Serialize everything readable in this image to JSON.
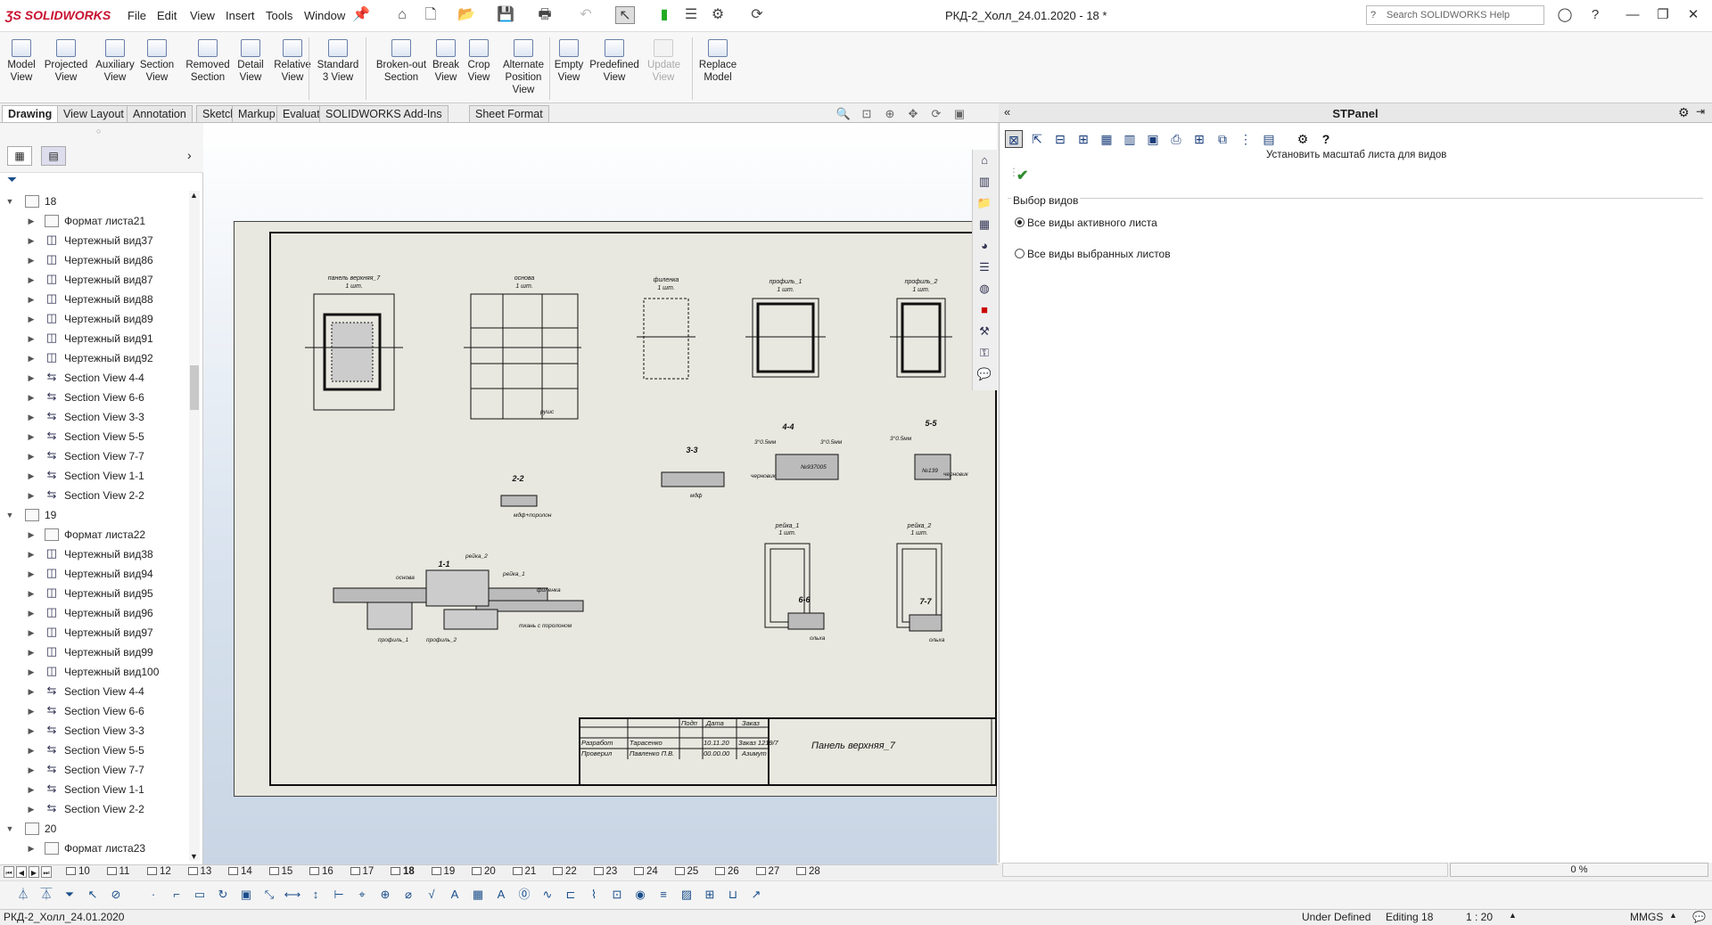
{
  "app": {
    "brand": "SOLIDWORKS",
    "doc_title": "РКД-2_Холл_24.01.2020 - 18 *",
    "search_placeholder": "Search SOLIDWORKS Help"
  },
  "menu": [
    "File",
    "Edit",
    "View",
    "Insert",
    "Tools",
    "Window"
  ],
  "ribbon": [
    {
      "label": "Model\nView"
    },
    {
      "label": "Projected\nView"
    },
    {
      "label": "Auxiliary\nView"
    },
    {
      "label": "Section\nView"
    },
    {
      "label": "Removed\nSection"
    },
    {
      "label": "Detail\nView"
    },
    {
      "label": "Relative\nView"
    },
    {
      "label": "Standard\n3 View"
    },
    {
      "label": "Broken-out\nSection"
    },
    {
      "label": "Break\nView"
    },
    {
      "label": "Crop\nView"
    },
    {
      "label": "Alternate\nPosition\nView"
    },
    {
      "label": "Empty\nView"
    },
    {
      "label": "Predefined\nView"
    },
    {
      "label": "Update\nView"
    },
    {
      "label": "Replace\nModel"
    }
  ],
  "tabs": [
    "Drawing",
    "View Layout",
    "Annotation",
    "Sketch",
    "Markup",
    "Evaluate",
    "SOLIDWORKS Add-Ins",
    "Sheet Format"
  ],
  "tree": [
    {
      "level": 0,
      "label": "18",
      "type": "sheet"
    },
    {
      "level": 1,
      "label": "Формат листа21",
      "type": "format"
    },
    {
      "level": 1,
      "label": "Чертежный вид37",
      "type": "view"
    },
    {
      "level": 1,
      "label": "Чертежный вид86",
      "type": "view"
    },
    {
      "level": 1,
      "label": "Чертежный вид87",
      "type": "view"
    },
    {
      "level": 1,
      "label": "Чертежный вид88",
      "type": "view"
    },
    {
      "level": 1,
      "label": "Чертежный вид89",
      "type": "view"
    },
    {
      "level": 1,
      "label": "Чертежный вид91",
      "type": "view"
    },
    {
      "level": 1,
      "label": "Чертежный вид92",
      "type": "view"
    },
    {
      "level": 1,
      "label": "Section View 4-4",
      "type": "section"
    },
    {
      "level": 1,
      "label": "Section View 6-6",
      "type": "section"
    },
    {
      "level": 1,
      "label": "Section View 3-3",
      "type": "section"
    },
    {
      "level": 1,
      "label": "Section View 5-5",
      "type": "section"
    },
    {
      "level": 1,
      "label": "Section View 7-7",
      "type": "section"
    },
    {
      "level": 1,
      "label": "Section View 1-1",
      "type": "section"
    },
    {
      "level": 1,
      "label": "Section View 2-2",
      "type": "section"
    },
    {
      "level": 0,
      "label": "19",
      "type": "sheet"
    },
    {
      "level": 1,
      "label": "Формат листа22",
      "type": "format"
    },
    {
      "level": 1,
      "label": "Чертежный вид38",
      "type": "view"
    },
    {
      "level": 1,
      "label": "Чертежный вид94",
      "type": "view"
    },
    {
      "level": 1,
      "label": "Чертежный вид95",
      "type": "view"
    },
    {
      "level": 1,
      "label": "Чертежный вид96",
      "type": "view"
    },
    {
      "level": 1,
      "label": "Чертежный вид97",
      "type": "view"
    },
    {
      "level": 1,
      "label": "Чертежный вид99",
      "type": "view"
    },
    {
      "level": 1,
      "label": "Чертежный вид100",
      "type": "view"
    },
    {
      "level": 1,
      "label": "Section View 4-4",
      "type": "section"
    },
    {
      "level": 1,
      "label": "Section View 6-6",
      "type": "section"
    },
    {
      "level": 1,
      "label": "Section View 3-3",
      "type": "section"
    },
    {
      "level": 1,
      "label": "Section View 5-5",
      "type": "section"
    },
    {
      "level": 1,
      "label": "Section View 7-7",
      "type": "section"
    },
    {
      "level": 1,
      "label": "Section View 1-1",
      "type": "section"
    },
    {
      "level": 1,
      "label": "Section View 2-2",
      "type": "section"
    },
    {
      "level": 0,
      "label": "20",
      "type": "sheet"
    },
    {
      "level": 1,
      "label": "Формат листа23",
      "type": "format"
    }
  ],
  "drawing": {
    "views": [
      "панель верхняя_7",
      "основа",
      "филенка",
      "профиль_1",
      "профиль_2",
      "рейка_1",
      "рейка_2"
    ],
    "qty": "1 шт.",
    "sections": [
      "4-4",
      "5-5",
      "3-3",
      "2-2",
      "1-1",
      "6-6",
      "7-7"
    ],
    "notes": [
      "мдф",
      "мдф+поролон",
      "рушс",
      "№937005",
      "№139",
      "ткань с поролоном",
      "ольха",
      "основа",
      "рейка_2",
      "рейка_1",
      "филенка",
      "профиль_1",
      "профиль_2",
      "черновик",
      "3°0.5мм"
    ],
    "title_block": {
      "part_name": "Панель верхняя_7",
      "hdr_sign": "Подп",
      "hdr_date": "Дата",
      "hdr_order": "Заказ",
      "row1_role": "Разработ",
      "row1_name": "Тарасенко",
      "row1_date": "10.11.20",
      "row2_role": "Проверил",
      "row2_name": "Павленко П.В.",
      "row2_date": "00.00.00",
      "order": "Заказ 1219/7",
      "company": "Азимут"
    }
  },
  "stpanel": {
    "title": "STPanel",
    "hint": "Установить масштаб листа для видов",
    "group": "Выбор видов",
    "options": [
      {
        "label": "Все виды активного листа",
        "checked": true
      },
      {
        "label": "Все виды выбранных листов",
        "checked": false
      }
    ],
    "progress": "0 %"
  },
  "sheet_tabs": [
    "10",
    "11",
    "12",
    "13",
    "14",
    "15",
    "16",
    "17",
    "18",
    "19",
    "20",
    "21",
    "22",
    "23",
    "24",
    "25",
    "26",
    "27",
    "28"
  ],
  "active_sheet": "18",
  "status": {
    "file": "РКД-2_Холл_24.01.2020",
    "state": "Under Defined",
    "editing": "Editing 18",
    "scale": "1 : 20",
    "units": "MMGS"
  }
}
